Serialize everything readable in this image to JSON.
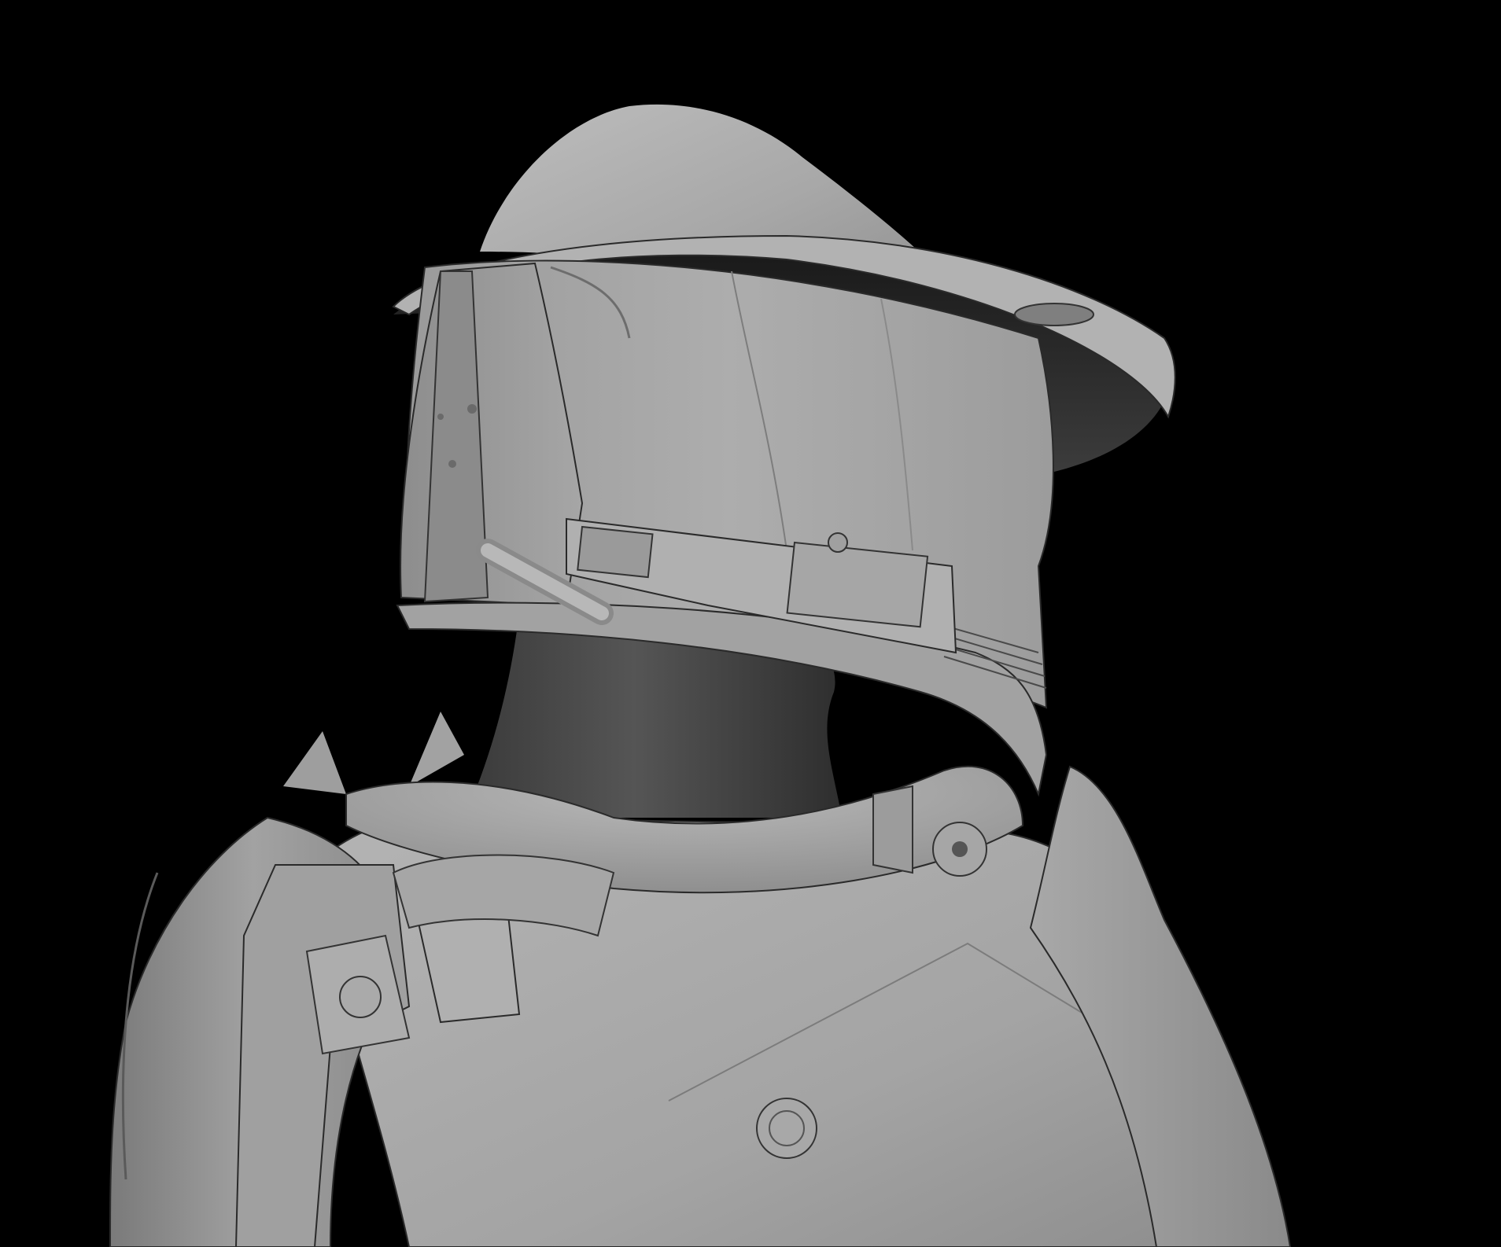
{
  "scene": {
    "subject": "armored-helmet-bust-render",
    "background_color": "#000000",
    "surface_color": "#a6a6a6",
    "shadow_color": "#4a4a4a",
    "highlight_color": "#c8c8c8",
    "line_color": "#2a2a2a"
  }
}
